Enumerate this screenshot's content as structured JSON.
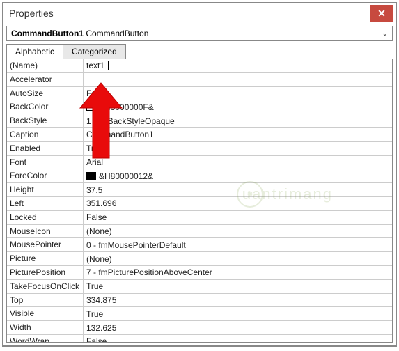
{
  "window": {
    "title": "Properties",
    "close_glyph": "✕"
  },
  "selector": {
    "name": "CommandButton1",
    "type": "CommandButton",
    "chevron": "⌄"
  },
  "tabs": {
    "alphabetic": "Alphabetic",
    "categorized": "Categorized"
  },
  "properties": [
    {
      "name": "(Name)",
      "value": "text1",
      "editing": true
    },
    {
      "name": "Accelerator",
      "value": ""
    },
    {
      "name": "AutoSize",
      "value": "False"
    },
    {
      "name": "BackColor",
      "value": "&H8000000F&",
      "swatch": "white"
    },
    {
      "name": "BackStyle",
      "value": "1 - fmBackStyleOpaque"
    },
    {
      "name": "Caption",
      "value": "CommandButton1"
    },
    {
      "name": "Enabled",
      "value": "True"
    },
    {
      "name": "Font",
      "value": "Arial"
    },
    {
      "name": "ForeColor",
      "value": "&H80000012&",
      "swatch": "black"
    },
    {
      "name": "Height",
      "value": "37.5"
    },
    {
      "name": "Left",
      "value": "351.696"
    },
    {
      "name": "Locked",
      "value": "False"
    },
    {
      "name": "MouseIcon",
      "value": "(None)"
    },
    {
      "name": "MousePointer",
      "value": "0 - fmMousePointerDefault"
    },
    {
      "name": "Picture",
      "value": "(None)"
    },
    {
      "name": "PicturePosition",
      "value": "7 - fmPicturePositionAboveCenter"
    },
    {
      "name": "TakeFocusOnClick",
      "value": "True"
    },
    {
      "name": "Top",
      "value": "334.875"
    },
    {
      "name": "Visible",
      "value": "True"
    },
    {
      "name": "Width",
      "value": "132.625"
    },
    {
      "name": "WordWrap",
      "value": "False"
    }
  ],
  "watermark": {
    "text": "uantrimang",
    "iconlabel": "Q"
  },
  "annotation": {
    "arrow_color": "#e80b0b"
  }
}
